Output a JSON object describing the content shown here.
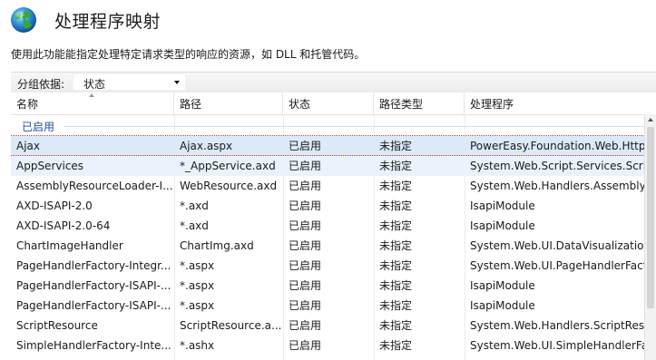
{
  "header": {
    "icon": "globe-icon",
    "title": "处理程序映射",
    "description": "使用此功能能指定处理特定请求类型的响应的资源，如 DLL 和托管代码。"
  },
  "groupby": {
    "label": "分组依据:",
    "value": "状态"
  },
  "table": {
    "columns": [
      "名称",
      "路径",
      "状态",
      "路径类型",
      "处理程序"
    ],
    "group": "已启用",
    "rows": [
      {
        "name": "Ajax",
        "path": "Ajax.aspx",
        "status": "已启用",
        "path_type": "未指定",
        "handler": "PowerEasy.Foundation.Web.HttpH"
      },
      {
        "name": "AppServices",
        "path": "*_AppService.axd",
        "status": "已启用",
        "path_type": "未指定",
        "handler": "System.Web.Script.Services.Script"
      },
      {
        "name": "AssemblyResourceLoader-I...",
        "path": "WebResource.axd",
        "status": "已启用",
        "path_type": "未指定",
        "handler": "System.Web.Handlers.AssemblyRe"
      },
      {
        "name": "AXD-ISAPI-2.0",
        "path": "*.axd",
        "status": "已启用",
        "path_type": "未指定",
        "handler": "IsapiModule"
      },
      {
        "name": "AXD-ISAPI-2.0-64",
        "path": "*.axd",
        "status": "已启用",
        "path_type": "未指定",
        "handler": "IsapiModule"
      },
      {
        "name": "ChartImageHandler",
        "path": "ChartImg.axd",
        "status": "已启用",
        "path_type": "未指定",
        "handler": "System.Web.UI.DataVisualization"
      },
      {
        "name": "PageHandlerFactory-Integr...",
        "path": "*.aspx",
        "status": "已启用",
        "path_type": "未指定",
        "handler": "System.Web.UI.PageHandlerFacto"
      },
      {
        "name": "PageHandlerFactory-ISAPI-...",
        "path": "*.aspx",
        "status": "已启用",
        "path_type": "未指定",
        "handler": "IsapiModule"
      },
      {
        "name": "PageHandlerFactory-ISAPI-...",
        "path": "*.aspx",
        "status": "已启用",
        "path_type": "未指定",
        "handler": "IsapiModule"
      },
      {
        "name": "ScriptResource",
        "path": "ScriptResource.a...",
        "status": "已启用",
        "path_type": "未指定",
        "handler": "System.Web.Handlers.ScriptReso"
      },
      {
        "name": "SimpleHandlerFactory-Inte...",
        "path": "*.ashx",
        "status": "已启用",
        "path_type": "未指定",
        "handler": "System.Web.UI.SimpleHandlerFac"
      }
    ]
  }
}
